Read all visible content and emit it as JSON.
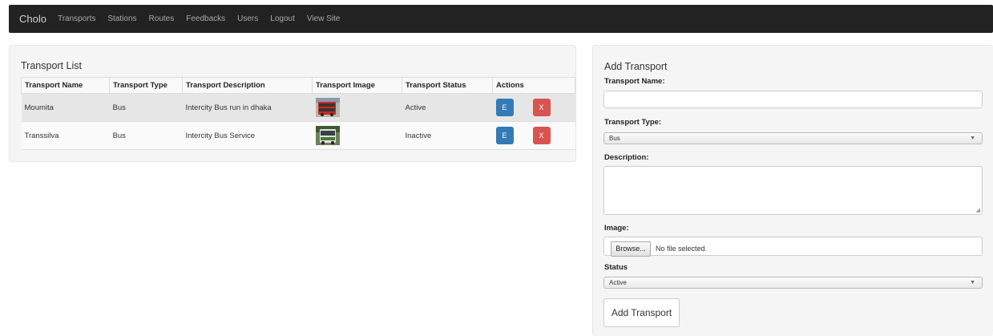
{
  "navbar": {
    "brand": "Cholo",
    "links": [
      "Transports",
      "Stations",
      "Routes",
      "Feedbacks",
      "Users",
      "Logout",
      "View Site"
    ]
  },
  "transport_list": {
    "title": "Transport List",
    "columns": [
      "Transport Name",
      "Transport Type",
      "Transport Description",
      "Transport Image",
      "Transport Status",
      "Actions"
    ],
    "rows": [
      {
        "name": "Moumita",
        "type": "Bus",
        "description": "Intercity Bus run in dhaka",
        "image_icon": "red-bus-photo",
        "status": "Active",
        "edit": "E",
        "delete": "X"
      },
      {
        "name": "Transsilva",
        "type": "Bus",
        "description": "Intercity Bus Service",
        "image_icon": "green-bus-photo",
        "status": "Inactive",
        "edit": "E",
        "delete": "X"
      }
    ]
  },
  "add_transport": {
    "title": "Add Transport",
    "name_label": "Transport Name:",
    "type_label": "Transport Type:",
    "type_value": "Bus",
    "description_label": "Description:",
    "image_label": "Image:",
    "browse_label": "Browse...",
    "file_text": "No file selected.",
    "status_label": "Status",
    "status_value": "Active",
    "submit_label": "Add Transport"
  },
  "colors": {
    "navbar": "#222222",
    "edit_button": "#337ab7",
    "delete_button": "#d9534f",
    "panel": "#f5f5f5"
  }
}
